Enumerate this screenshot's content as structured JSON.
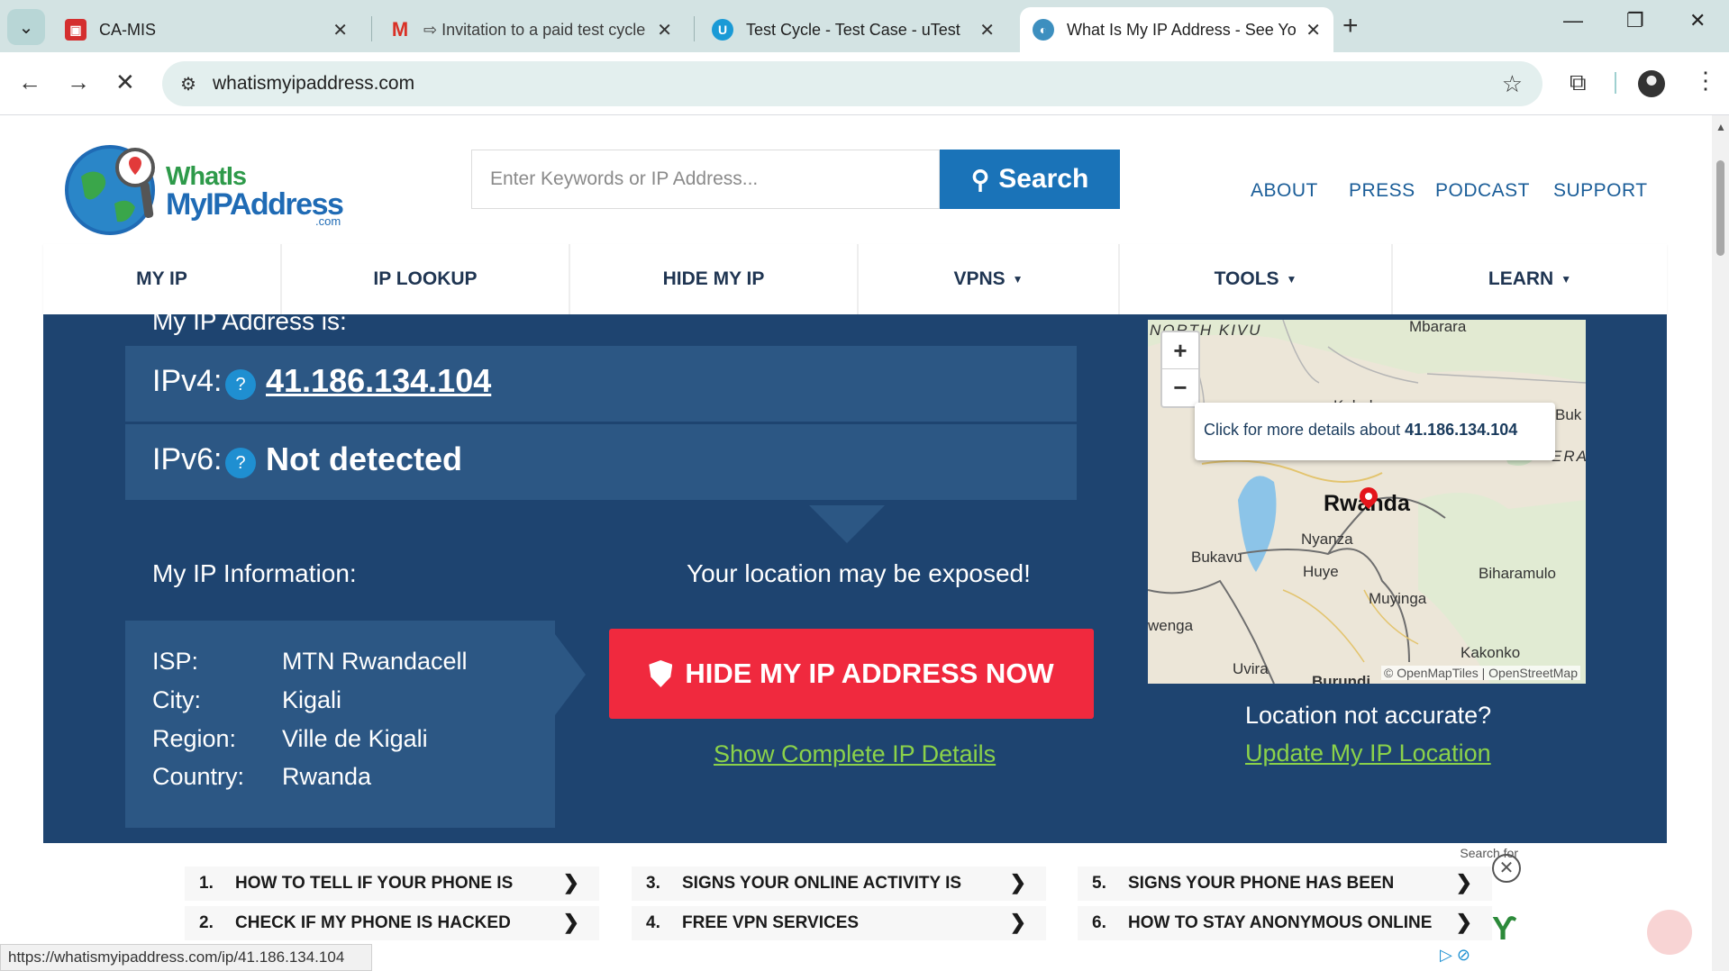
{
  "browser": {
    "tabs": [
      {
        "title": "CA-MIS",
        "icon": "ca-mis-favicon"
      },
      {
        "title": "⇨ Invitation to a paid test cycle",
        "icon": "gmail-icon"
      },
      {
        "title": "Test Cycle - Test Case - uTest",
        "icon": "utest-icon"
      },
      {
        "title": "What Is My IP Address - See Yo",
        "icon": "globe-icon"
      }
    ],
    "url": "whatismyipaddress.com",
    "status_url": "https://whatismyipaddress.com/ip/41.186.134.104"
  },
  "site": {
    "logo": {
      "line1": "WhatIs",
      "line2": "MyIPAddress",
      "line3": ".com"
    },
    "search": {
      "placeholder": "Enter Keywords or IP Address...",
      "button": "Search"
    },
    "top_links": [
      "ABOUT",
      "PRESS",
      "PODCAST",
      "SUPPORT"
    ],
    "nav": [
      "MY IP",
      "IP LOOKUP",
      "HIDE MY IP",
      "VPNS",
      "TOOLS",
      "LEARN"
    ]
  },
  "hero": {
    "heading": "My IP Address is:",
    "ipv4_label": "IPv4:",
    "ipv4_value": "41.186.134.104",
    "ipv6_label": "IPv6:",
    "ipv6_value": "Not detected",
    "help": "?",
    "info_title": "My IP Information:",
    "exposed": "Your location may be exposed!",
    "info": {
      "isp_label": "ISP:",
      "isp": "MTN Rwandacell",
      "city_label": "City:",
      "city": "Kigali",
      "region_label": "Region:",
      "region": "Ville de Kigali",
      "country_label": "Country:",
      "country": "Rwanda"
    },
    "hide_button": "HIDE MY IP ADDRESS NOW",
    "show_details": "Show Complete IP Details",
    "location_question": "Location not accurate?",
    "update_location": "Update My IP Location"
  },
  "map": {
    "popup_text": "Click for more details about",
    "popup_ip": "41.186.134.104",
    "zoom_in": "+",
    "zoom_out": "−",
    "labels": [
      "NORTH KIVU",
      "Mbarara",
      "Kabale",
      "Buk",
      "ERA",
      "Rwanda",
      "Nyanza",
      "Bukavu",
      "Huye",
      "Biharamulo",
      "Muyinga",
      "wenga",
      "Kakonko",
      "Uvira",
      "Burundi"
    ],
    "attribution": "© OpenMapTiles | OpenStreetMap"
  },
  "ad": {
    "search_for": "Search for",
    "items": [
      {
        "num": "1.",
        "text": "HOW TO TELL IF YOUR PHONE IS"
      },
      {
        "num": "2.",
        "text": "CHECK IF MY PHONE IS HACKED"
      },
      {
        "num": "3.",
        "text": "SIGNS YOUR ONLINE ACTIVITY IS"
      },
      {
        "num": "4.",
        "text": "FREE VPN SERVICES"
      },
      {
        "num": "5.",
        "text": "SIGNS YOUR PHONE HAS BEEN"
      },
      {
        "num": "6.",
        "text": "HOW TO STAY ANONYMOUS ONLINE"
      }
    ]
  },
  "colors": {
    "hero_bg": "#1e4470",
    "box_bg": "#2c5784",
    "hide_button": "#f0293e",
    "link_green": "#8bd24a",
    "search_button": "#1a73b8"
  }
}
